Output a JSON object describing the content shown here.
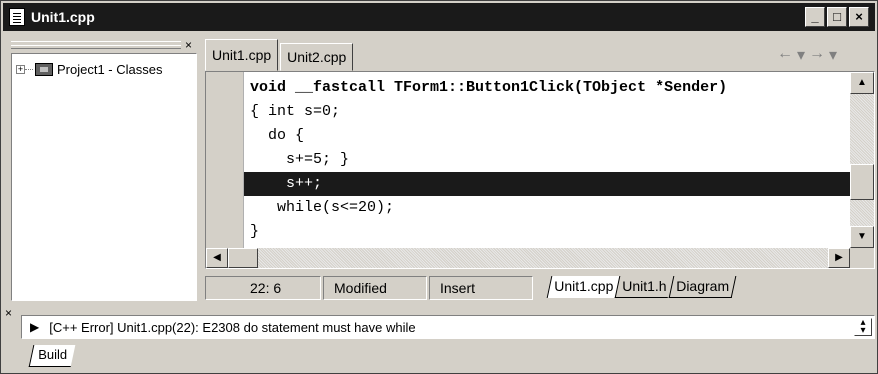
{
  "window": {
    "title": "Unit1.cpp",
    "minimize": "_",
    "maximize": "□",
    "close": "×"
  },
  "class_explorer": {
    "close": "×",
    "item_label": "Project1 - Classes",
    "expander": "+"
  },
  "editor_tabs": [
    {
      "label": "Unit1.cpp"
    },
    {
      "label": "Unit2.cpp"
    }
  ],
  "nav": {
    "back": "←",
    "forward": "→"
  },
  "code_lines": [
    {
      "text": "void __fastcall TForm1::Button1Click(TObject *Sender)"
    },
    {
      "text": "{ int s=0;"
    },
    {
      "text": "  do {"
    },
    {
      "text": "    s+=5; }"
    },
    {
      "text": "    s++;"
    },
    {
      "text": "   while(s<=20);"
    },
    {
      "text": "}"
    }
  ],
  "status": {
    "position": "22:  6",
    "modified": "Modified",
    "mode": "Insert"
  },
  "file_tabs": [
    {
      "label": "Unit1.cpp"
    },
    {
      "label": "Unit1.h"
    },
    {
      "label": "Diagram"
    }
  ],
  "messages": {
    "close": "×",
    "error_text": "[C++ Error] Unit1.cpp(22): E2308 do statement must have while"
  },
  "bottom_tabs": [
    {
      "label": "Build"
    }
  ]
}
